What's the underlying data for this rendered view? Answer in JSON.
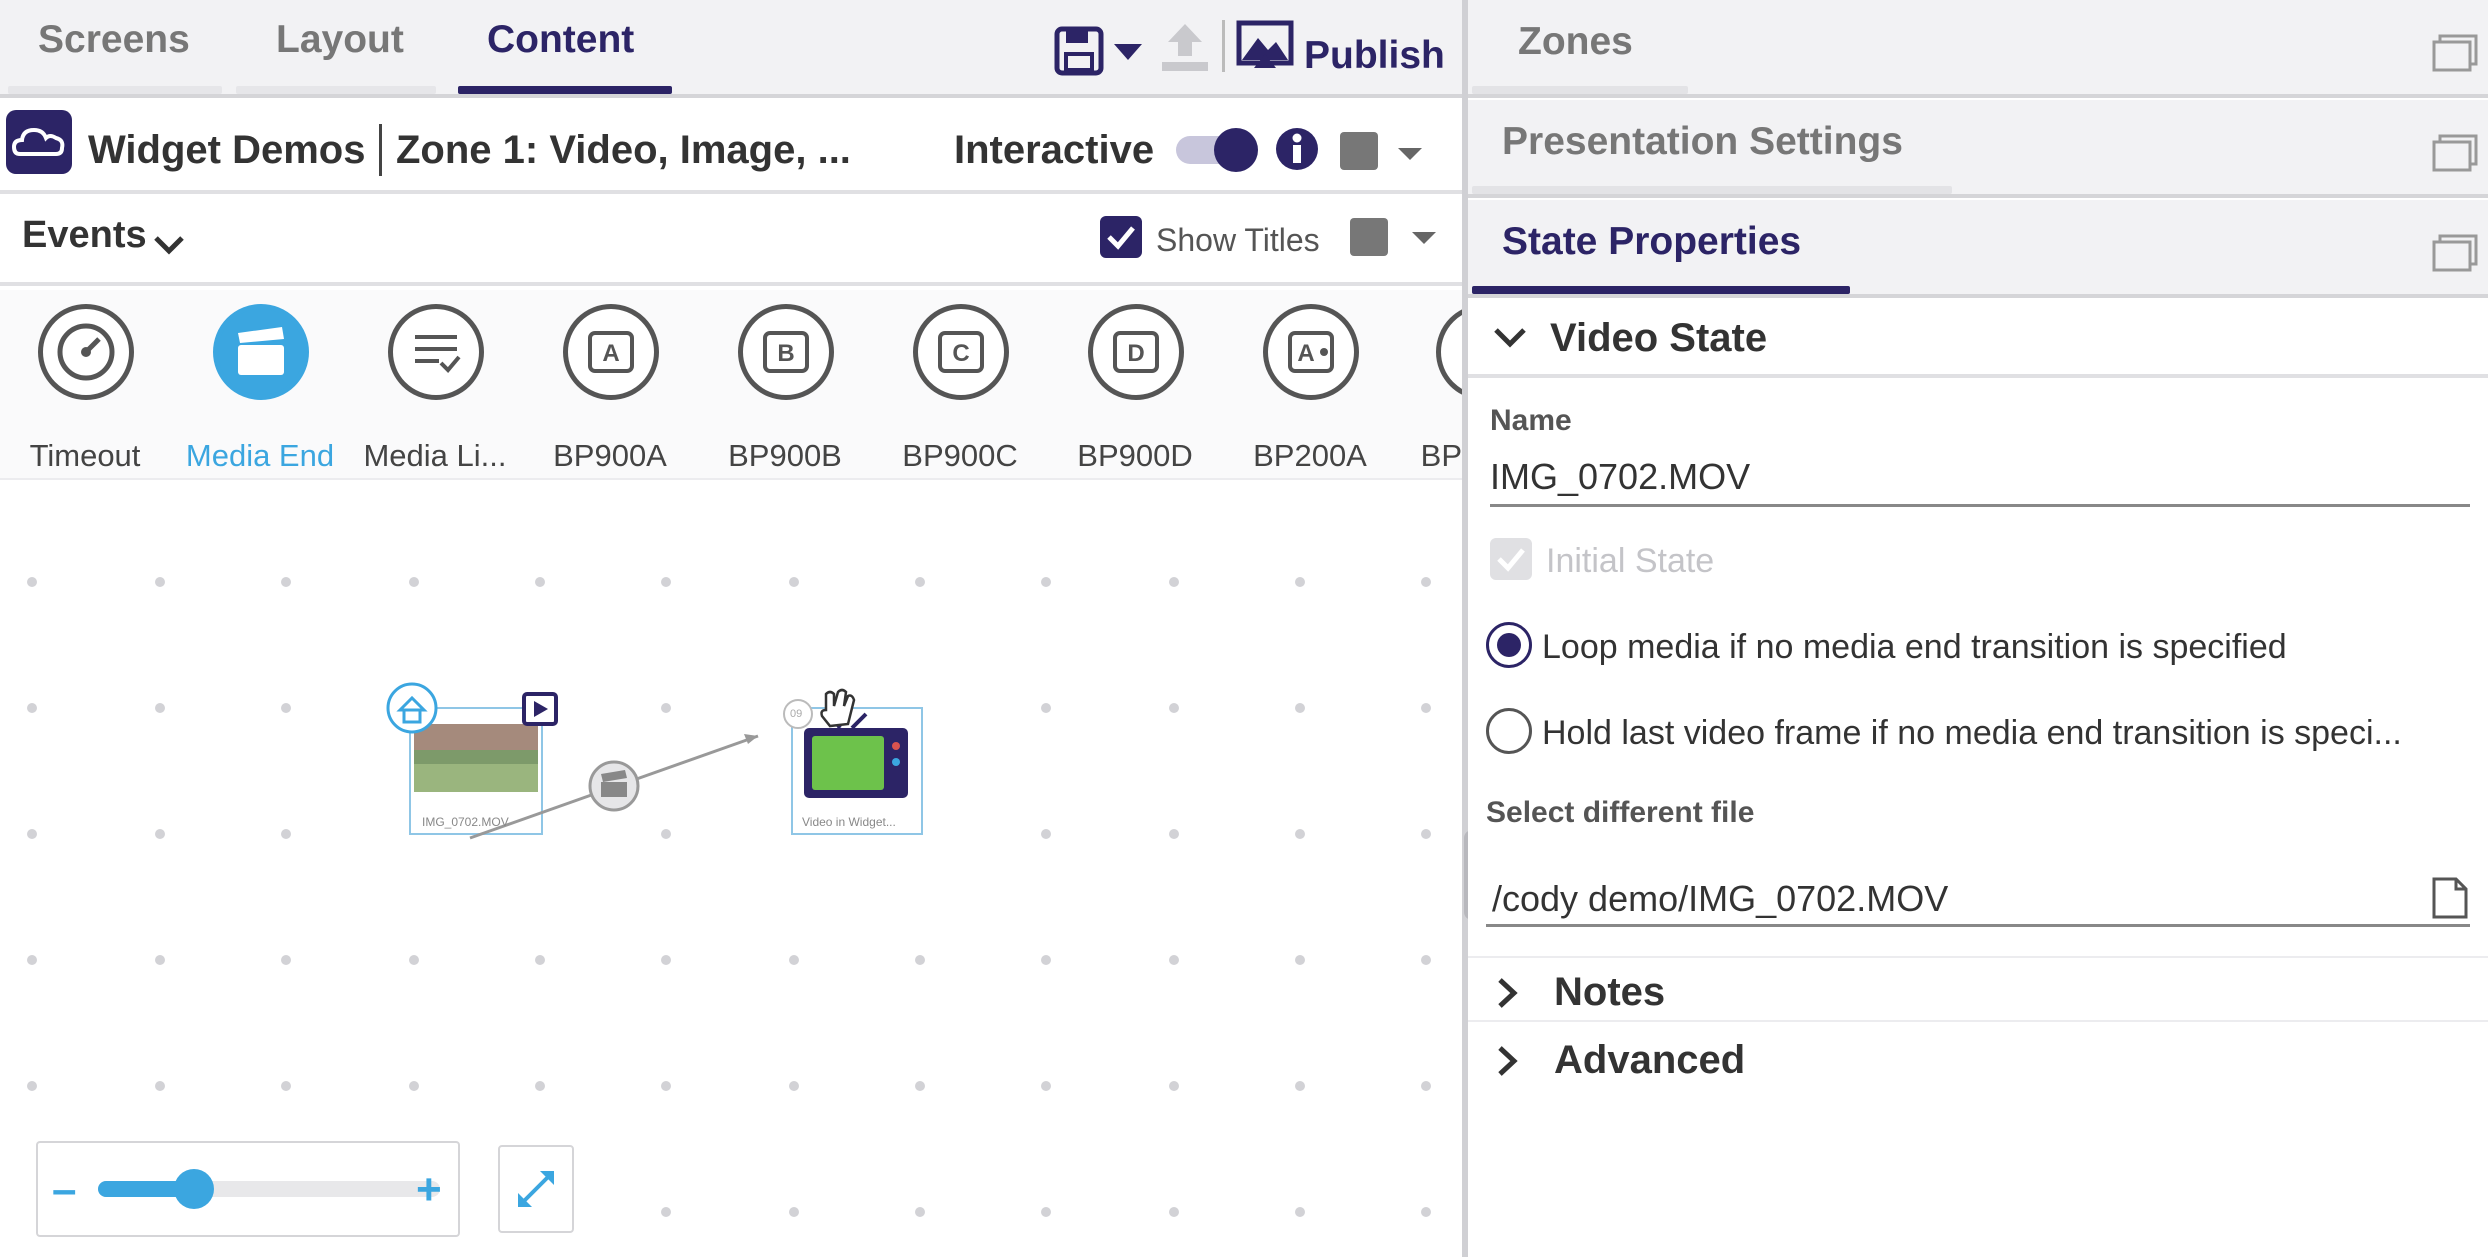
{
  "left_tabs": [
    {
      "label": "Screens"
    },
    {
      "label": "Layout"
    },
    {
      "label": "Content"
    }
  ],
  "toolbar": {
    "publish_label": "Publish",
    "save_icon": "save-icon",
    "upload_icon": "upload-icon",
    "publish_icon": "publish-icon"
  },
  "presentation": {
    "title": "Widget Demos",
    "zone": "Zone 1: Video, Image, ...",
    "interactive_label": "Interactive",
    "interactive_on": true
  },
  "events": {
    "label": "Events",
    "show_titles_label": "Show Titles",
    "show_titles_checked": true
  },
  "palette": [
    {
      "label": "Timeout",
      "icon": "timer-icon"
    },
    {
      "label": "Media End",
      "icon": "clapperboard-icon",
      "selected": true
    },
    {
      "label": "Media Li...",
      "icon": "media-list-icon"
    },
    {
      "label": "BP900A",
      "icon": "bp-a-icon"
    },
    {
      "label": "BP900B",
      "icon": "bp-b-icon"
    },
    {
      "label": "BP900C",
      "icon": "bp-c-icon"
    },
    {
      "label": "BP900D",
      "icon": "bp-d-icon"
    },
    {
      "label": "BP200A",
      "icon": "bp-a-icon"
    },
    {
      "label": "BP",
      "icon": "bp-icon"
    }
  ],
  "canvas": {
    "state1_caption": "IMG_0702.MOV",
    "state2_caption": "Video in Widget...",
    "state2_badge": "09"
  },
  "zoom": {
    "minus": "–",
    "plus": "+",
    "level": 0.22
  },
  "right_panels": {
    "zones": "Zones",
    "presentation_settings": "Presentation Settings",
    "state_properties": "State Properties"
  },
  "video_state": {
    "title": "Video State",
    "name_label": "Name",
    "name_value": "IMG_0702.MOV",
    "initial_state_label": "Initial State",
    "radio_loop": "Loop media if no media end transition is specified",
    "radio_hold": "Hold last video frame if no media end transition is speci...",
    "select_file_label": "Select different file",
    "file_path": "/cody demo/IMG_0702.MOV"
  },
  "sections": {
    "notes": "Notes",
    "advanced": "Advanced"
  },
  "colors": {
    "accent": "#2c2466",
    "highlight": "#3ba6e0"
  }
}
